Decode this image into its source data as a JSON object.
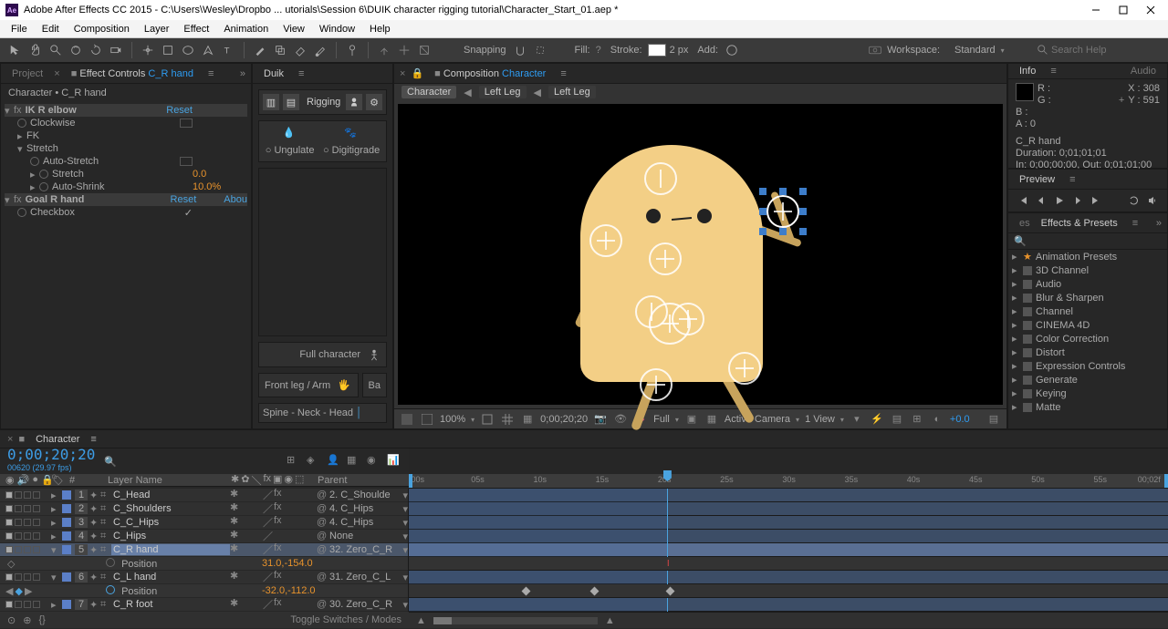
{
  "app": {
    "title": "Adobe After Effects CC 2015 - C:\\Users\\Wesley\\Dropbo ... utorials\\Session 6\\DUIK character rigging tutorial\\Character_Start_01.aep *"
  },
  "menu": [
    "File",
    "Edit",
    "Composition",
    "Layer",
    "Effect",
    "Animation",
    "View",
    "Window",
    "Help"
  ],
  "toolbar": {
    "snapping": "Snapping",
    "fill": "Fill:",
    "stroke": "Stroke:",
    "stroke_px": "2 px",
    "add": "Add:",
    "workspace_label": "Workspace:",
    "workspace_value": "Standard",
    "search_placeholder": "Search Help"
  },
  "panels": {
    "project_tab": "Project",
    "effect_controls": "Effect Controls",
    "effect_controls_layer": "C_R hand",
    "ec_header": "Character • C_R hand",
    "duik_tab": "Duik",
    "composition": "Composition",
    "composition_name": "Character",
    "crumbs": [
      "Character",
      "Left Leg",
      "Left Leg"
    ],
    "info_tab": "Info",
    "audio_tab": "Audio",
    "preview_tab": "Preview",
    "presets_tab": "Effects & Presets",
    "presets_tab2": "es"
  },
  "effects": {
    "ik": {
      "name": "IK R elbow",
      "reset": "Reset",
      "clockwise": "Clockwise",
      "fk": "FK",
      "stretch_group": "Stretch",
      "auto_stretch": "Auto-Stretch",
      "stretch": "Stretch",
      "stretch_val": "0.0",
      "auto_shrink": "Auto-Shrink",
      "auto_shrink_val": "10.0%"
    },
    "goal": {
      "name": "Goal R hand",
      "reset": "Reset",
      "about": "Abou",
      "checkbox": "Checkbox",
      "checkbox_val": "✓"
    }
  },
  "duik": {
    "rigging": "Rigging",
    "ungulate": "Ungulate",
    "digitigrade": "Digitigrade",
    "full_character": "Full character",
    "front_leg": "Front leg / Arm",
    "back": "Ba",
    "spine": "Spine - Neck - Head"
  },
  "info": {
    "R": "R :",
    "G": "G :",
    "B": "B :",
    "A": "A :",
    "A_val": "0",
    "X": "X :",
    "X_val": "308",
    "Y": "Y :",
    "Y_val": "591",
    "layer": "C_R hand",
    "duration": "Duration: 0;01;01;01",
    "inout": "In: 0;00;00;00, Out: 0;01;01;00"
  },
  "presets": {
    "search_placeholder": "",
    "items": [
      "Animation Presets",
      "3D Channel",
      "Audio",
      "Blur & Sharpen",
      "Channel",
      "CINEMA 4D",
      "Color Correction",
      "Distort",
      "Expression Controls",
      "Generate",
      "Keying",
      "Matte"
    ]
  },
  "comp_footer": {
    "zoom": "100%",
    "time": "0;00;20;20",
    "res": "Full",
    "camera": "Active Camera",
    "views": "1 View",
    "exposure": "+0.0"
  },
  "timeline": {
    "tab": "Character",
    "time": "0;00;20;20",
    "fps": "00620 (29.97 fps)",
    "cols": {
      "index": "#",
      "layer_name": "Layer Name",
      "parent": "Parent"
    },
    "toggle": "Toggle Switches / Modes",
    "ruler": [
      ":00s",
      "05s",
      "10s",
      "15s",
      "20s",
      "25s",
      "30s",
      "35s",
      "40s",
      "45s",
      "50s",
      "55s",
      "00;02f"
    ],
    "layers": [
      {
        "idx": "1",
        "name": "C_Head",
        "parent": "2. C_Shoulde"
      },
      {
        "idx": "2",
        "name": "C_Shoulders",
        "parent": "4. C_Hips"
      },
      {
        "idx": "3",
        "name": "C_C_Hips",
        "parent": "4. C_Hips"
      },
      {
        "idx": "4",
        "name": "C_Hips",
        "parent": "None"
      },
      {
        "idx": "5",
        "name": "C_R hand",
        "parent": "32. Zero_C_R",
        "sel": true,
        "prop": {
          "name": "Position",
          "val": "31.0,-154.0"
        }
      },
      {
        "idx": "6",
        "name": "C_L hand",
        "parent": "31. Zero_C_L",
        "prop": {
          "name": "Position",
          "val": "-32.0,-112.0"
        }
      },
      {
        "idx": "7",
        "name": "C_R foot",
        "parent": "30. Zero_C_R"
      }
    ]
  }
}
